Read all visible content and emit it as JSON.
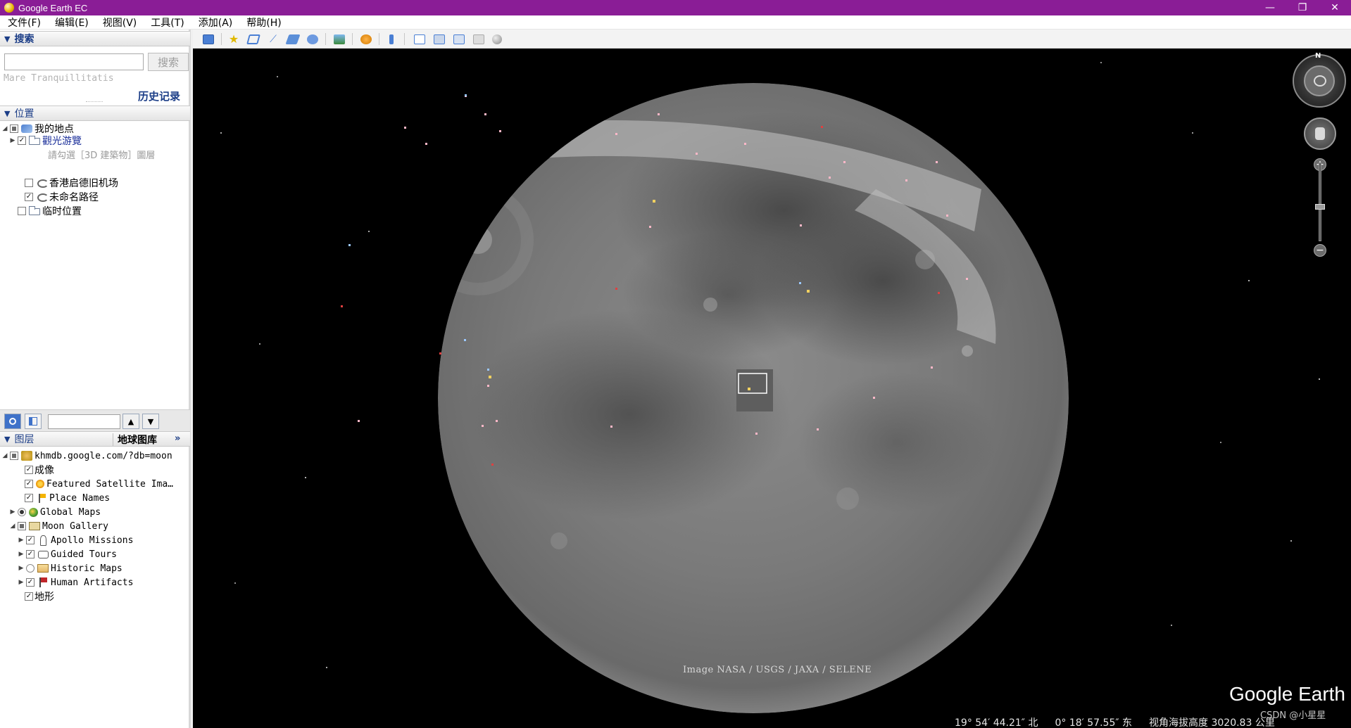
{
  "window": {
    "title": "Google Earth EC",
    "controls": [
      "—",
      "❐",
      "✕"
    ]
  },
  "menu": [
    "文件(F)",
    "编辑(E)",
    "视图(V)",
    "工具(T)",
    "添加(A)",
    "帮助(H)"
  ],
  "search": {
    "header": "搜索",
    "input_value": "",
    "button": "搜索",
    "hint": "Mare Tranquillitatis",
    "history": "历史记录"
  },
  "places": {
    "header": "位置",
    "items": [
      {
        "label": "我的地点",
        "checked": "mixed",
        "expanded": true
      },
      {
        "label": "觀光游覽",
        "checked": true
      },
      {
        "label": "請勾選［3D 建築物］圖層",
        "note": true
      },
      {
        "label": "香港启德旧机场",
        "checked": false
      },
      {
        "label": "未命名路径",
        "checked": true
      },
      {
        "label": "临时位置",
        "checked": false
      }
    ]
  },
  "layers": {
    "header": "图层",
    "gallery_tab": "地球图库",
    "more": "»",
    "items": [
      {
        "label": "khmdb.google.com/?db=moon",
        "checked": "mixed"
      },
      {
        "label": "成像",
        "checked": true
      },
      {
        "label": "Featured Satellite Ima…",
        "checked": true
      },
      {
        "label": "Place Names",
        "checked": true
      },
      {
        "label": "Global Maps",
        "radio": true
      },
      {
        "label": "Moon Gallery",
        "checked": "mixed"
      },
      {
        "label": "Apollo Missions",
        "checked": true
      },
      {
        "label": "Guided Tours",
        "checked": true
      },
      {
        "label": "Historic Maps",
        "radio": false
      },
      {
        "label": "Human Artifacts",
        "checked": true
      },
      {
        "label": "地形",
        "checked": true
      }
    ]
  },
  "map": {
    "attribution": "Image NASA / USGS / JAXA / SELENE",
    "brand": "Google Earth",
    "watermark": "CSDN @小星星",
    "latitude": "19° 54′ 44.21″ 北",
    "longitude": "0° 18′ 57.55″ 东",
    "altitude": "视角海拔高度 3020.83 公里",
    "north": "N"
  },
  "colors": {
    "titlebar": "#8a1d96",
    "panel_header_text": "#1b3d87",
    "space": "#000000"
  }
}
